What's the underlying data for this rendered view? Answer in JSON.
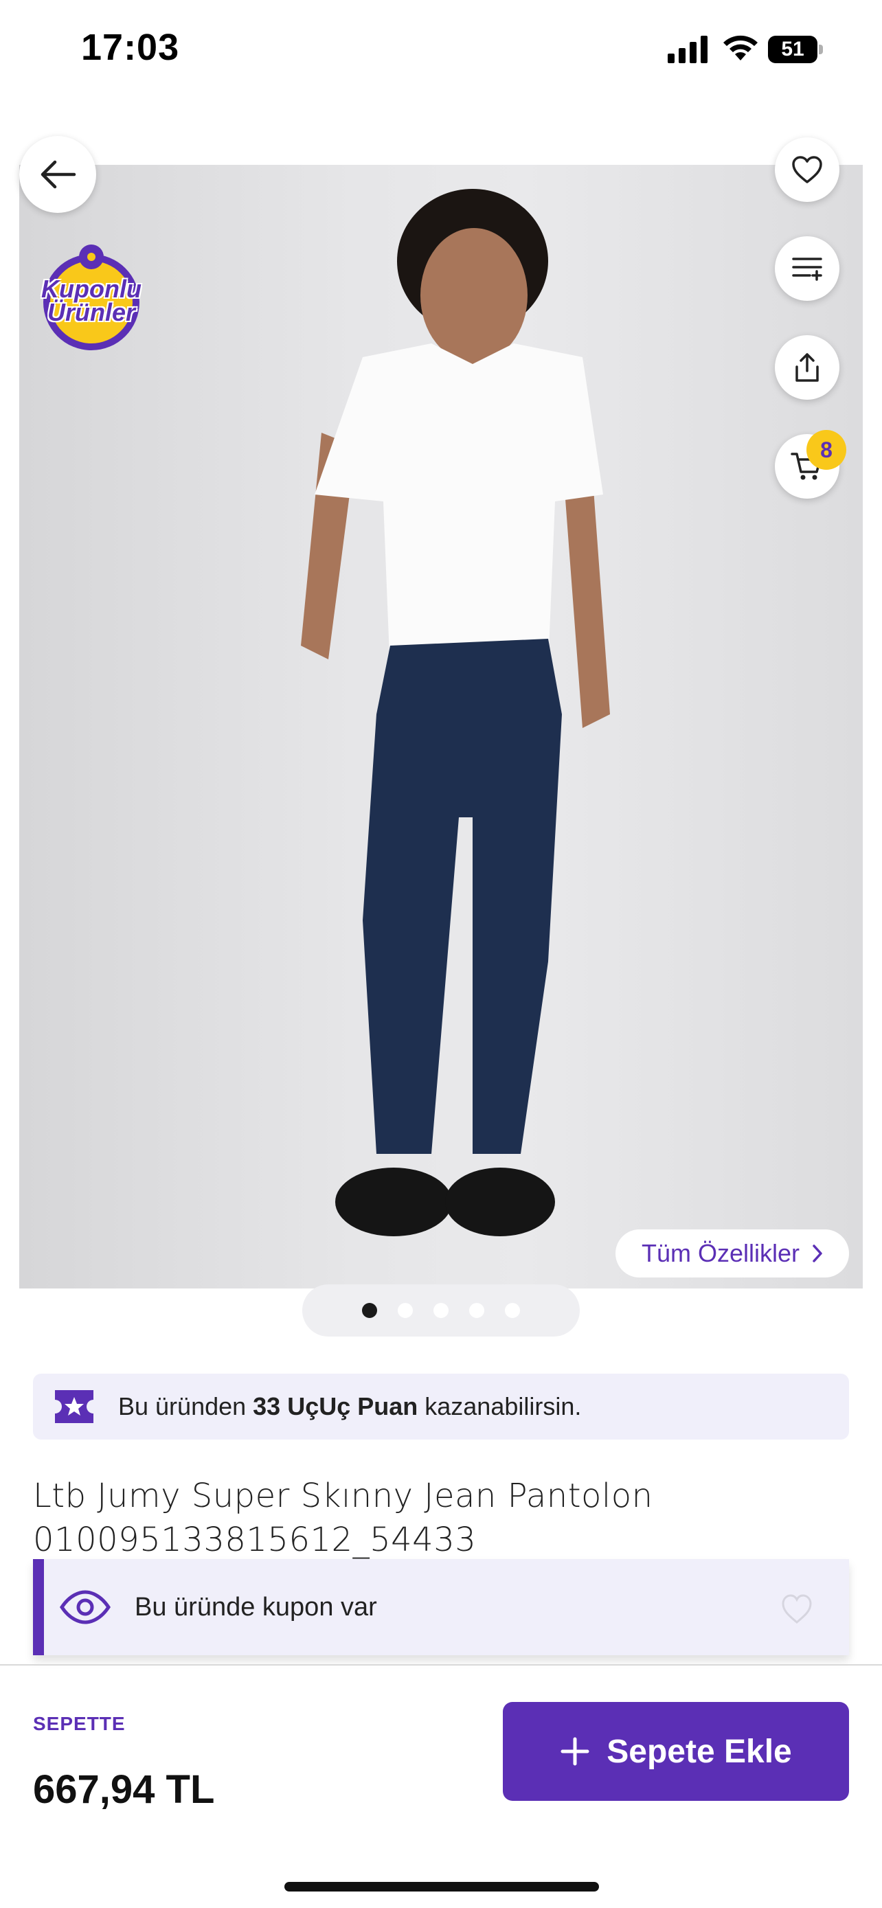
{
  "status_bar": {
    "time": "17:03",
    "battery": "51"
  },
  "product_image": {
    "coupon_badge": "Kuponlu Ürünler",
    "all_features_label": "Tüm Özellikler",
    "page_count": 5,
    "active_page": 1
  },
  "cart": {
    "badge_count": "8"
  },
  "icons": {
    "back": "arrow-left-icon",
    "favorite": "heart-icon",
    "filter": "filter-list-icon",
    "share": "share-icon",
    "cart": "cart-icon"
  },
  "points_banner": {
    "prefix": "Bu üründen ",
    "highlight": "33 UçUç Puan",
    "suffix": " kazanabilirsin."
  },
  "product": {
    "title_line1": "Ltb Jumy Super Skınny Jean Pantolon",
    "title_line2": "010095133815612_54433"
  },
  "coupon_bar": {
    "text": "Bu üründe kupon var"
  },
  "price_section": {
    "label": "SEPETTE",
    "price": "667,94 TL"
  },
  "add_to_cart": {
    "label": "Sepete Ekle"
  },
  "colors": {
    "accent": "#5b2fb5",
    "badge": "#f9c81a",
    "banner_bg": "#f0effa"
  }
}
